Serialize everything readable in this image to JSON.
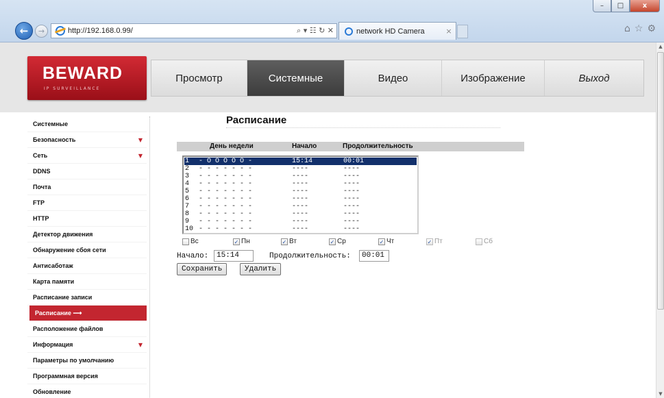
{
  "browser": {
    "url": "http://192.168.0.99/",
    "tab_title": "network HD Camera",
    "addr_icons": "⌕ ▾ ☷ ↻ ✕",
    "tab_close": "×",
    "win_min": "–",
    "win_max": "□",
    "win_close": "x",
    "tool_icons": [
      "home-icon",
      "star-icon",
      "gear-icon"
    ]
  },
  "logo": {
    "main": "BEWARD",
    "sub": "IP SURVEILLANCE"
  },
  "menu": [
    {
      "label": "Просмотр",
      "active": false
    },
    {
      "label": "Системные",
      "active": true
    },
    {
      "label": "Видео",
      "active": false
    },
    {
      "label": "Изображение",
      "active": false
    },
    {
      "label": "Выход",
      "active": false
    }
  ],
  "sidebar": {
    "items": [
      {
        "label": "Системные",
        "arrow": ""
      },
      {
        "label": "Безопасность",
        "arrow": "▼"
      },
      {
        "label": "Сеть",
        "arrow": "▼"
      },
      {
        "label": "DDNS",
        "arrow": ""
      },
      {
        "label": "Почта",
        "arrow": ""
      },
      {
        "label": "FTP",
        "arrow": ""
      },
      {
        "label": "HTTP",
        "arrow": ""
      },
      {
        "label": "Детектор движения",
        "arrow": ""
      },
      {
        "label": "Обнаружение сбоя сети",
        "arrow": ""
      },
      {
        "label": "Антисаботаж",
        "arrow": ""
      },
      {
        "label": "Карта памяти",
        "arrow": ""
      },
      {
        "label": "Расписание записи",
        "arrow": ""
      },
      {
        "label": "Расписание ⟶",
        "arrow": "",
        "active": true
      },
      {
        "label": "Расположение файлов",
        "arrow": ""
      },
      {
        "label": "Информация",
        "arrow": "▼"
      },
      {
        "label": "Параметры по умолчанию",
        "arrow": ""
      },
      {
        "label": "Программная версия",
        "arrow": ""
      },
      {
        "label": "Обновление",
        "arrow": ""
      }
    ]
  },
  "content": {
    "title": "Расписание",
    "headers": {
      "day": "День недели",
      "start": "Начало",
      "duration": "Продолжительность"
    },
    "rows": [
      {
        "num": "1",
        "days": "- O O O O O -",
        "start": "15:14",
        "dur": "00:01",
        "selected": true
      },
      {
        "num": "2",
        "days": "- - - - - - -",
        "start": "----",
        "dur": "----"
      },
      {
        "num": "3",
        "days": "- - - - - - -",
        "start": "----",
        "dur": "----"
      },
      {
        "num": "4",
        "days": "- - - - - - -",
        "start": "----",
        "dur": "----"
      },
      {
        "num": "5",
        "days": "- - - - - - -",
        "start": "----",
        "dur": "----"
      },
      {
        "num": "6",
        "days": "- - - - - - -",
        "start": "----",
        "dur": "----"
      },
      {
        "num": "7",
        "days": "- - - - - - -",
        "start": "----",
        "dur": "----"
      },
      {
        "num": "8",
        "days": "- - - - - - -",
        "start": "----",
        "dur": "----"
      },
      {
        "num": "9",
        "days": "- - - - - - -",
        "start": "----",
        "dur": "----"
      },
      {
        "num": "10",
        "days": "- - - - - - -",
        "start": "----",
        "dur": "----"
      }
    ],
    "days": [
      {
        "label": "Вс",
        "checked": false,
        "disabled": false
      },
      {
        "label": "Пн",
        "checked": true,
        "disabled": false
      },
      {
        "label": "Вт",
        "checked": true,
        "disabled": false
      },
      {
        "label": "Ср",
        "checked": true,
        "disabled": false
      },
      {
        "label": "Чт",
        "checked": true,
        "disabled": false
      },
      {
        "label": "Пт",
        "checked": true,
        "disabled": true
      },
      {
        "label": "Сб",
        "checked": false,
        "disabled": true
      }
    ],
    "start_label": "Начало:",
    "start_value": "15:14",
    "duration_label": "Продолжительность:",
    "duration_value": "00:01",
    "save_label": "Сохранить",
    "delete_label": "Удалить"
  }
}
